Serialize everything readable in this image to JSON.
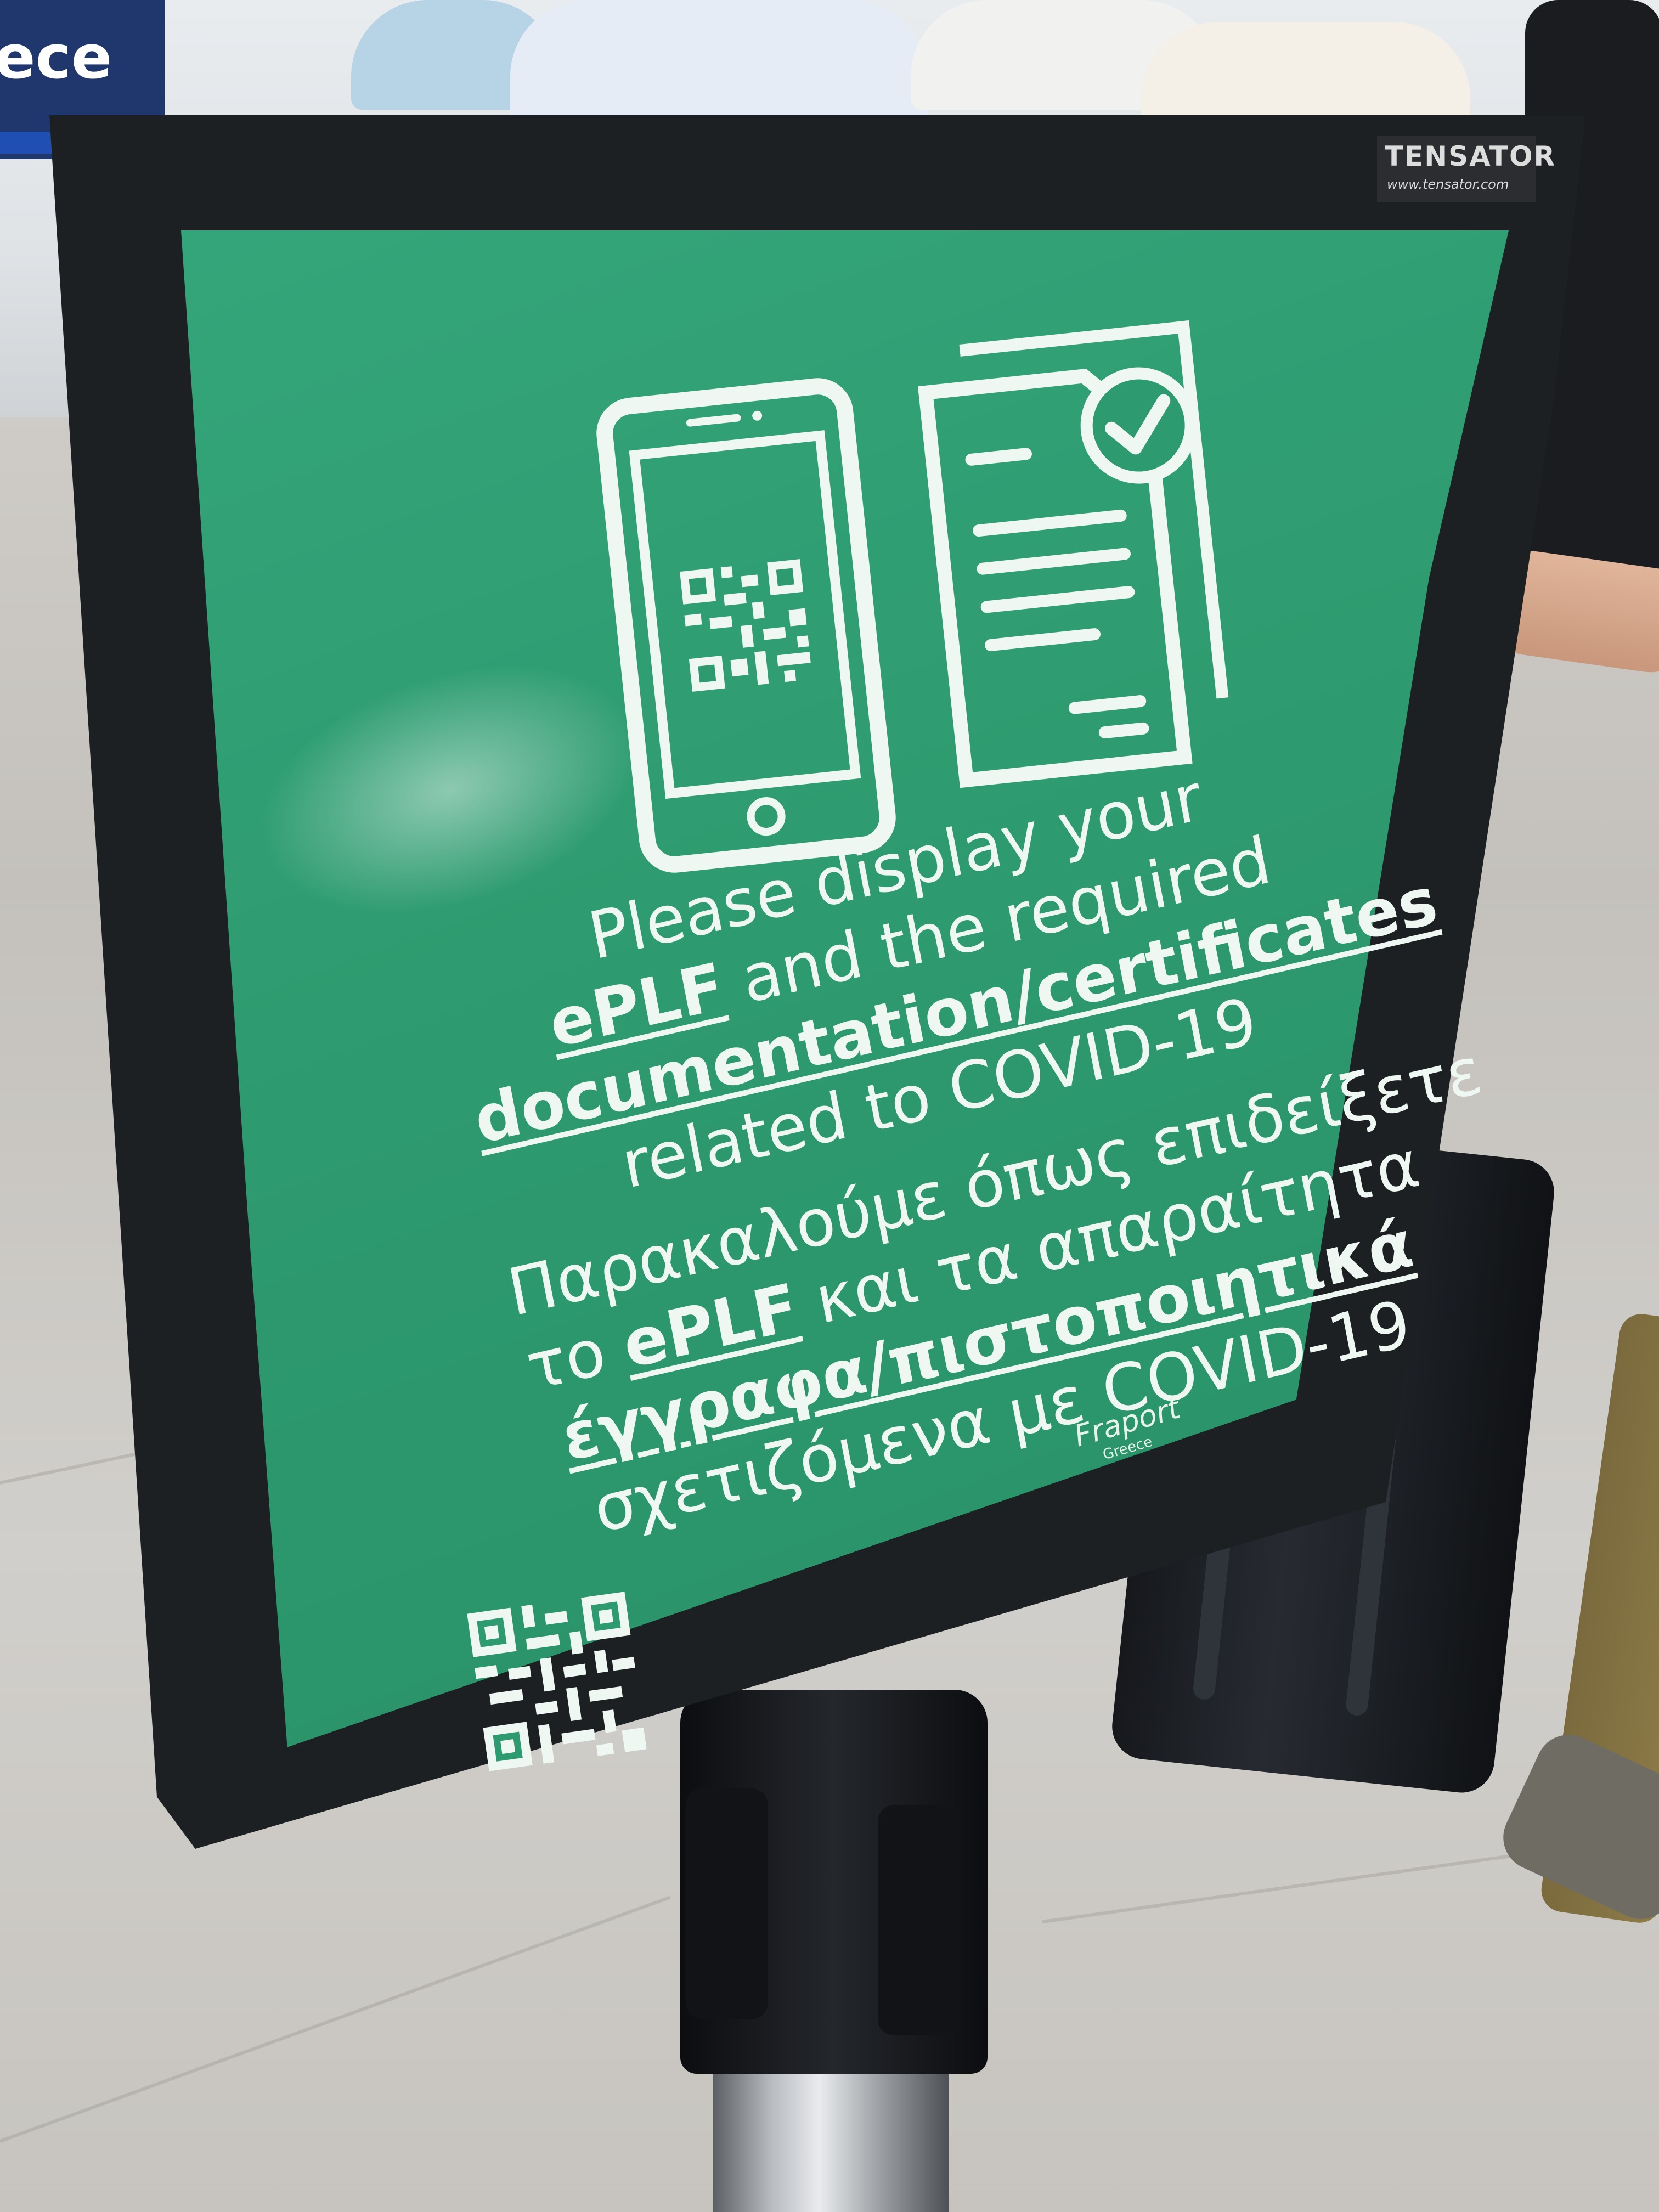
{
  "background": {
    "wall_sign_fragment": "ece"
  },
  "sticker": {
    "brand": "TENSATOR",
    "url": "www.tensator.com"
  },
  "sign": {
    "english": {
      "line1": "Please display your",
      "line2_link": "ePLF",
      "line2_rest": "and the required",
      "line3_link": "documentation/certificates",
      "line4": "related to COVID-19"
    },
    "greek": {
      "line1": "Παρακαλούμε όπως επιδείξετε",
      "line2_prefix": "το",
      "line2_link": "ePLF",
      "line2_rest": "και τα απαραίτητα",
      "line3_link": "έγγραφα/πιστοποιητικά",
      "line4": "σχετιζόμενα με COVID-19"
    },
    "logo": {
      "name": "Fraport",
      "sub": "Greece"
    },
    "icons": [
      "phone-qr-icon",
      "document-check-icon",
      "qr-code-icon"
    ]
  },
  "colors": {
    "sign_green": "#2e9a6f",
    "frame": "#1d2023",
    "text": "#eef7f1",
    "wall_blue": "#20376e",
    "belt_blue": "#1f4fb3"
  }
}
